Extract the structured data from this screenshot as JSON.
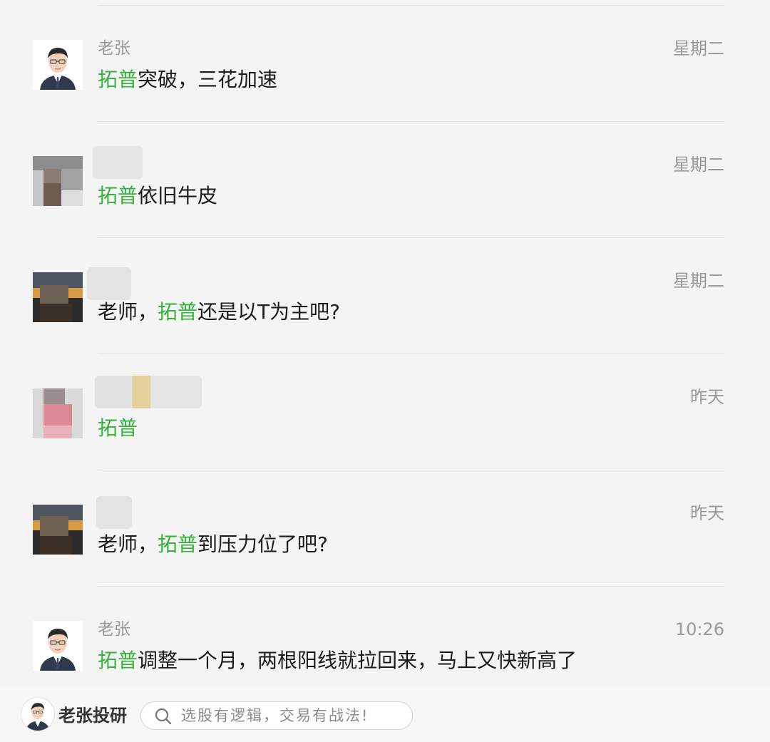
{
  "conversations": [
    {
      "name": "老张",
      "time": "星期二",
      "message": {
        "highlight": "拓普",
        "before": "",
        "after": "突破，三花加速"
      }
    },
    {
      "name": "",
      "time": "星期二",
      "message": {
        "highlight": "拓普",
        "before": "",
        "after": "依旧牛皮"
      }
    },
    {
      "name": "",
      "time": "星期二",
      "message": {
        "highlight": "拓普",
        "before": "老师，",
        "after": "还是以T为主吧?"
      }
    },
    {
      "name": "",
      "time": "昨天",
      "message": {
        "highlight": "拓普",
        "before": "",
        "after": ""
      }
    },
    {
      "name": "",
      "time": "昨天",
      "message": {
        "highlight": "拓普",
        "before": "老师，",
        "after": "到压力位了吧?"
      }
    },
    {
      "name": "老张",
      "time": "10:26",
      "message": {
        "highlight": "拓普",
        "before": "",
        "after": "调整一个月，两根阳线就拉回来，马上又快新高了"
      }
    }
  ],
  "footer": {
    "brand_name": "老张投研",
    "search_placeholder": "选股有逻辑，交易有战法!"
  },
  "colors": {
    "highlight": "#35b13c",
    "background": "#f4f4f4",
    "secondary_text": "#9a9a9a"
  },
  "icons": {
    "search": "search-icon",
    "avatar": "avatar-icon"
  }
}
